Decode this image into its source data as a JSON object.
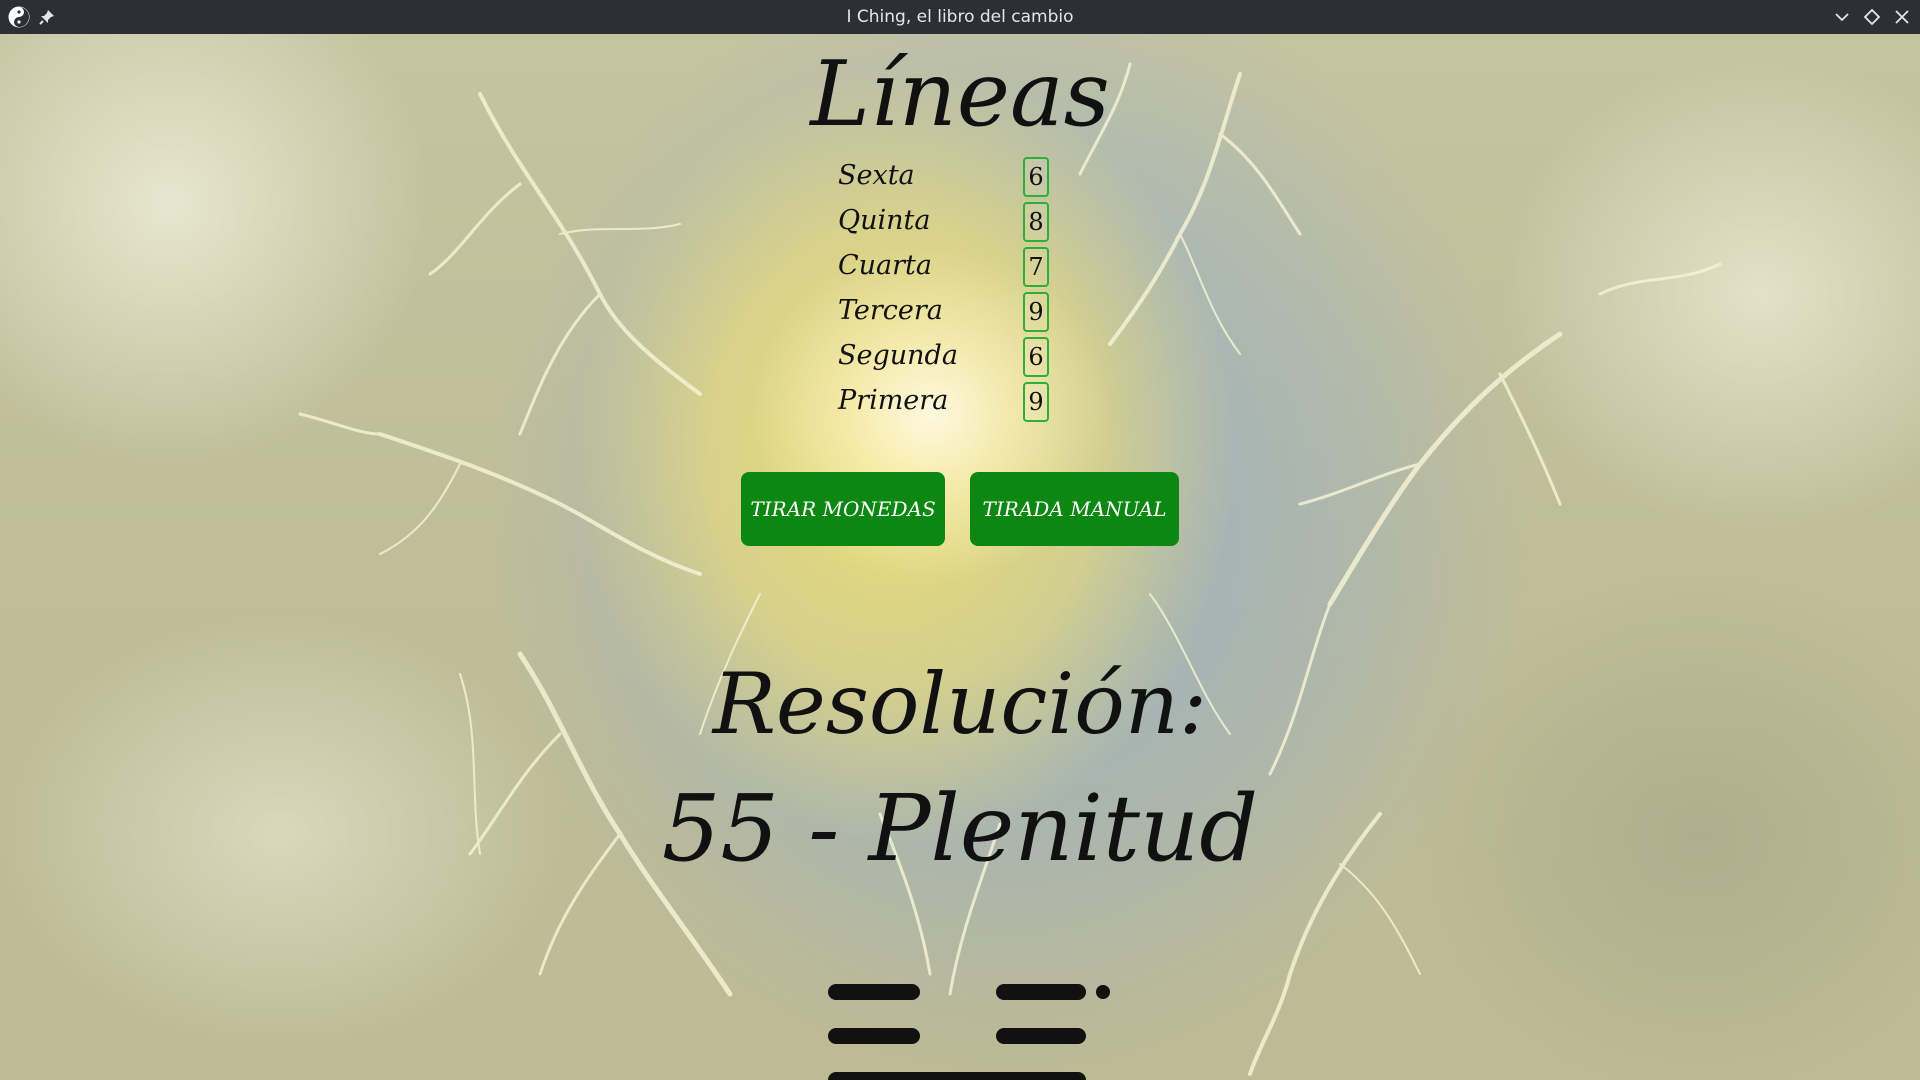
{
  "window": {
    "title": "I Ching, el libro del cambio"
  },
  "main": {
    "heading": "Líneas",
    "lines": [
      {
        "label": "Sexta",
        "value": "6"
      },
      {
        "label": "Quinta",
        "value": "8"
      },
      {
        "label": "Cuarta",
        "value": "7"
      },
      {
        "label": "Tercera",
        "value": "9"
      },
      {
        "label": "Segunda",
        "value": "6"
      },
      {
        "label": "Primera",
        "value": "9"
      }
    ],
    "buttons": {
      "tirar_monedas": "TIRAR MONEDAS",
      "tirada_manual": "TIRADA MANUAL"
    },
    "resolution_heading": "Resolución:",
    "result": "55 - Plenitud",
    "hexagram_visible_lines": [
      {
        "type": "broken",
        "changing": true
      },
      {
        "type": "broken",
        "changing": false
      },
      {
        "type": "solid",
        "changing": false
      }
    ]
  },
  "colors": {
    "titlebar": "#2c3036",
    "button_green": "#0b8712",
    "value_border": "#2fae3a",
    "text": "#111111"
  },
  "icons": {
    "app": "yin-yang-icon",
    "pin": "pin-icon",
    "minimize": "chevron-down-icon",
    "maximize": "diamond-icon",
    "close": "close-icon"
  }
}
